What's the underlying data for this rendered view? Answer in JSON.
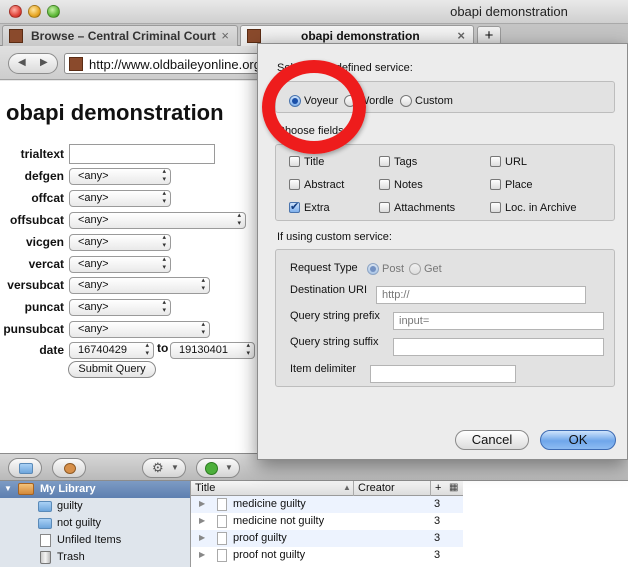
{
  "window": {
    "title": "obapi demonstration"
  },
  "tabs": [
    {
      "label": "Browse – Central Criminal Court"
    },
    {
      "label": "obapi demonstration"
    }
  ],
  "tab_close_glyph": "×",
  "new_tab_glyph": "+",
  "navbar": {
    "url": "http://www.oldbaileyonline.org"
  },
  "page": {
    "title": "obapi demonstration",
    "fields": [
      {
        "label": "trialtext"
      },
      {
        "label": "defgen",
        "value": "<any>"
      },
      {
        "label": "offcat",
        "value": "<any>"
      },
      {
        "label": "offsubcat",
        "value": "<any>"
      },
      {
        "label": "vicgen",
        "value": "<any>"
      },
      {
        "label": "vercat",
        "value": "<any>"
      },
      {
        "label": "versubcat",
        "value": "<any>"
      },
      {
        "label": "puncat",
        "value": "<any>"
      },
      {
        "label": "punsubcat",
        "value": "<any>"
      },
      {
        "label": "date",
        "from": "16740429",
        "to_label": "to",
        "to": "19130401"
      }
    ],
    "submit_label": "Submit Query"
  },
  "library": {
    "sidebar": [
      {
        "label": "My Library"
      },
      {
        "label": "guilty"
      },
      {
        "label": "not guilty"
      },
      {
        "label": "Unfiled Items"
      },
      {
        "label": "Trash"
      }
    ],
    "columns": {
      "title": "Title",
      "creator": "Creator",
      "count": "+"
    },
    "items": [
      {
        "title": "medicine guilty",
        "count": "3"
      },
      {
        "title": "medicine not guilty",
        "count": "3"
      },
      {
        "title": "proof guilty",
        "count": "3"
      },
      {
        "title": "proof not guilty",
        "count": "3"
      }
    ]
  },
  "dialog": {
    "service_label": "Select a predefined service:",
    "services": [
      {
        "label": "Voyeur",
        "selected": true
      },
      {
        "label": "Wordle",
        "selected": false
      },
      {
        "label": "Custom",
        "selected": false
      }
    ],
    "fields_label": "Choose fields:",
    "fields": [
      {
        "label": "Title",
        "checked": false
      },
      {
        "label": "Tags",
        "checked": false
      },
      {
        "label": "URL",
        "checked": false
      },
      {
        "label": "Abstract",
        "checked": false
      },
      {
        "label": "Notes",
        "checked": false
      },
      {
        "label": "Place",
        "checked": false
      },
      {
        "label": "Extra",
        "checked": true
      },
      {
        "label": "Attachments",
        "checked": false
      },
      {
        "label": "Loc. in Archive",
        "checked": false
      }
    ],
    "custom_label": "If using custom service:",
    "request_type_label": "Request Type",
    "request_types": [
      {
        "label": "Post",
        "selected": true
      },
      {
        "label": "Get",
        "selected": false
      }
    ],
    "destination_label": "Destination URI",
    "destination_value": "http://",
    "prefix_label": "Query string prefix",
    "prefix_value": "input=",
    "suffix_label": "Query string suffix",
    "suffix_value": "",
    "delimiter_label": "Item delimiter",
    "delimiter_value": "",
    "cancel_label": "Cancel",
    "ok_label": "OK"
  },
  "colors": {
    "accent": "#6fa6ea",
    "annotation": "#ee1c1c",
    "sidebar_selected": "#5d7fb0"
  },
  "icons": [
    "folder-icon",
    "trash-icon",
    "document-icon",
    "gear-icon",
    "add-icon"
  ]
}
